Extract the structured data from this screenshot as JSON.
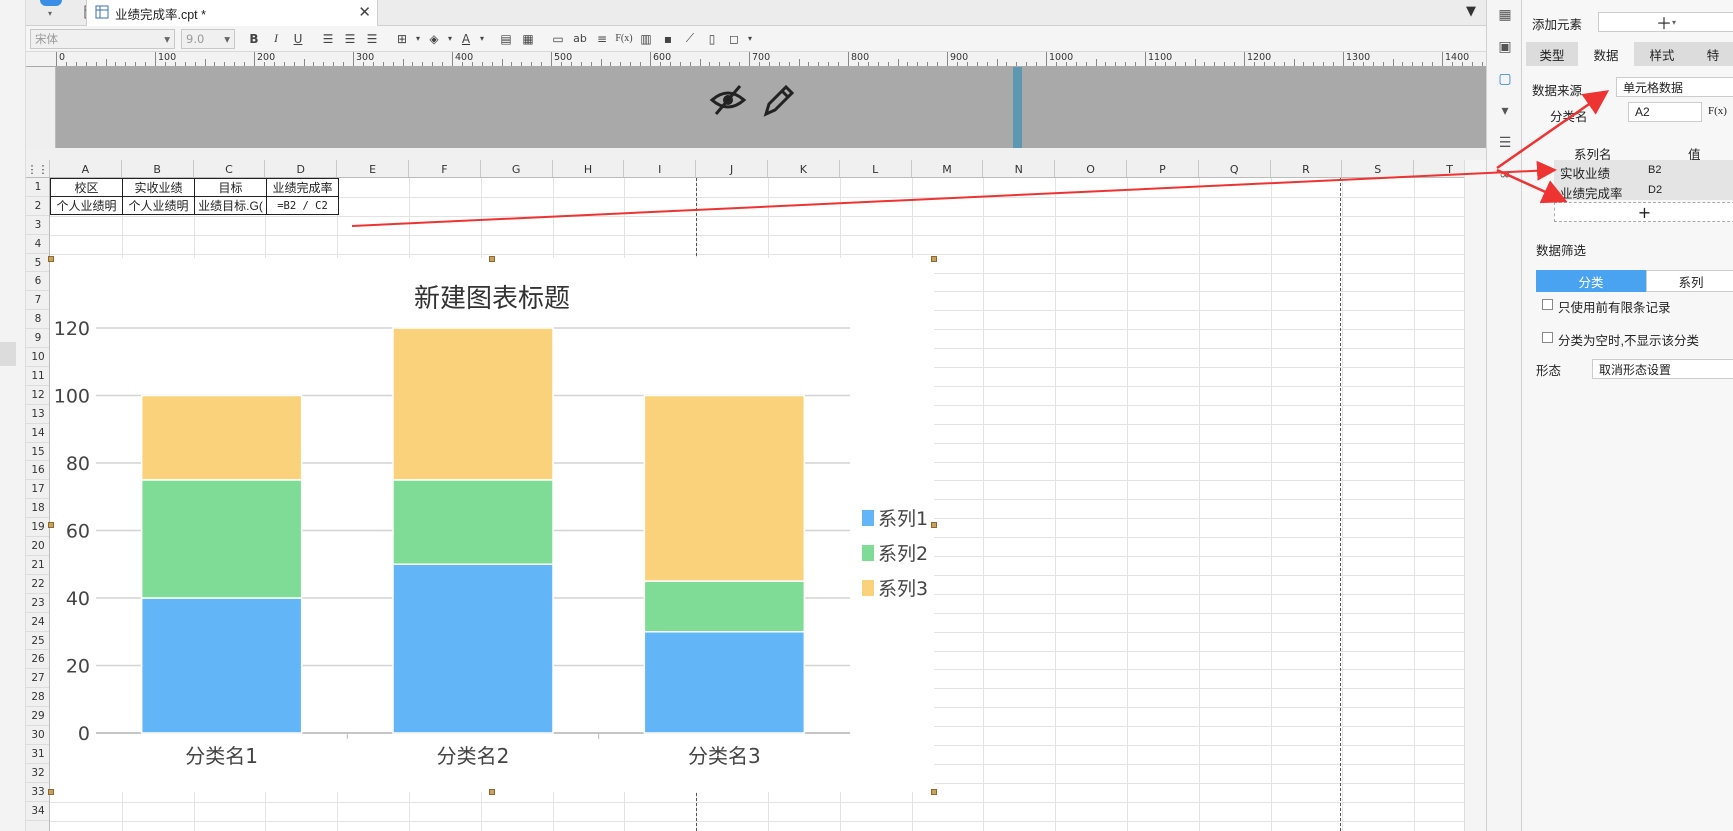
{
  "tab": {
    "title": "业绩完成率.cpt *"
  },
  "toolbar": {
    "font_name": "宋体",
    "font_size": "9.0",
    "bold": "B",
    "italic": "I",
    "underline": "U",
    "text_glyph": "ab",
    "formula": "F(x)"
  },
  "ruler": {
    "labels": [
      "0",
      "100",
      "200",
      "300",
      "400",
      "500",
      "600",
      "700",
      "800",
      "900",
      "1000",
      "1100",
      "1200",
      "1300",
      "1400"
    ]
  },
  "columns": [
    "A",
    "B",
    "C",
    "D",
    "E",
    "F",
    "G",
    "H",
    "I",
    "J",
    "K",
    "L",
    "M",
    "N",
    "O",
    "P",
    "Q",
    "R",
    "S",
    "T"
  ],
  "rows": [
    "1",
    "2",
    "3",
    "4",
    "5",
    "6",
    "7",
    "8",
    "9",
    "10",
    "11",
    "12",
    "13",
    "14",
    "15",
    "16",
    "17",
    "18",
    "19",
    "20",
    "21",
    "22",
    "23",
    "24",
    "25",
    "26",
    "27",
    "28",
    "29",
    "30",
    "31",
    "32",
    "33",
    "34"
  ],
  "cells": {
    "a1": "校区",
    "b1": "实收业绩",
    "c1": "目标",
    "d1": "业绩完成率",
    "a2": "个人业绩明",
    "b2": "个人业绩明",
    "c2": "业绩目标.G(",
    "d2": "=B2 / C2"
  },
  "chart_data": {
    "type": "bar",
    "stacked": true,
    "title": "新建图表标题",
    "categories": [
      "分类名1",
      "分类名2",
      "分类名3"
    ],
    "series": [
      {
        "name": "系列1",
        "values": [
          40,
          50,
          30
        ],
        "color": "#62b5f6"
      },
      {
        "name": "系列2",
        "values": [
          35,
          25,
          15
        ],
        "color": "#7fdc96"
      },
      {
        "name": "系列3",
        "values": [
          25,
          45,
          55
        ],
        "color": "#fbd27c"
      }
    ],
    "ylim": [
      0,
      120
    ],
    "yticks": [
      "0",
      "20",
      "40",
      "60",
      "80",
      "100",
      "120"
    ],
    "grid": true,
    "legend": "right"
  },
  "panel": {
    "add_element": "添加元素",
    "tabs": [
      "类型",
      "数据",
      "样式",
      "特"
    ],
    "data_source_label": "数据来源",
    "data_source_value": "单元格数据",
    "category_label": "分类名",
    "category_value": "A2",
    "formula_btn": "F(x)",
    "series_col": "系列名",
    "value_col": "值",
    "series_rows": [
      {
        "name": "实收业绩",
        "value": "B2"
      },
      {
        "name": "业绩完成率",
        "value": "D2"
      }
    ],
    "add_plus": "+",
    "filter_label": "数据筛选",
    "seg_category": "分类",
    "seg_series": "系列",
    "check1": "只使用前有限条记录",
    "check2": "分类为空时,不显示该分类",
    "shape_label": "形态",
    "shape_value": "取消形态设置"
  }
}
